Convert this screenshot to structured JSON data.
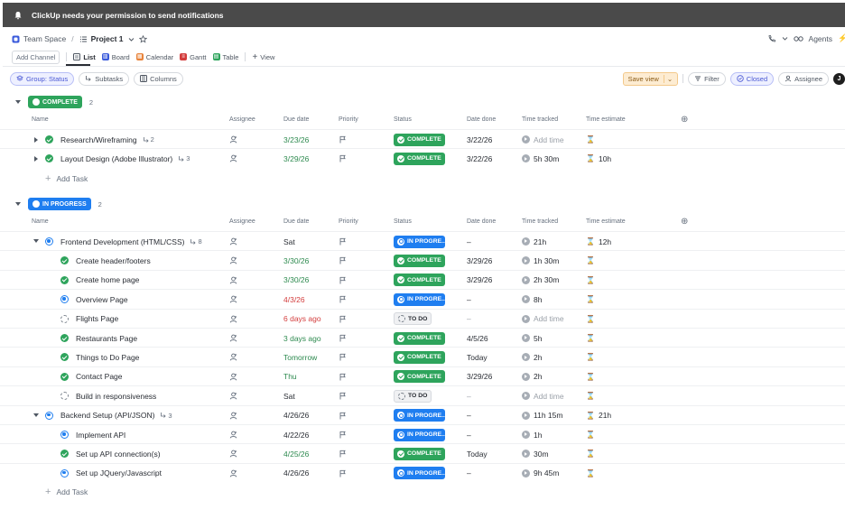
{
  "notification": {
    "text": "ClickUp needs your permission to send notifications"
  },
  "breadcrumb": {
    "space": "Team Space",
    "project": "Project 1"
  },
  "topright": {
    "agents": "Agents"
  },
  "views": {
    "add_channel": "Add Channel",
    "list": "List",
    "board": "Board",
    "calendar": "Calendar",
    "gantt": "Gantt",
    "table": "Table",
    "add_view": "View"
  },
  "toolbar": {
    "group": "Group: Status",
    "subtasks": "Subtasks",
    "columns": "Columns",
    "save_view": "Save view",
    "filter": "Filter",
    "closed": "Closed",
    "assignee": "Assignee",
    "avatar": "J"
  },
  "columns": {
    "name": "Name",
    "assignee": "Assignee",
    "due_date": "Due date",
    "priority": "Priority",
    "status": "Status",
    "date_done": "Date done",
    "time_tracked": "Time tracked",
    "time_estimate": "Time estimate"
  },
  "add_task": "Add Task",
  "colors": {
    "complete": "#2ea45c",
    "in_progress": "#1f7ef0",
    "todo": "#f0f1f3"
  },
  "groups": [
    {
      "label": "COMPLETE",
      "status": "complete",
      "count": "2",
      "tasks": [
        {
          "name": "Research/Wireframing",
          "status": "complete",
          "status_label": "COMPLETE",
          "subtasks": "2",
          "due": "3/23/26",
          "due_color": "green",
          "done": "3/22/26",
          "tracked": "Add time",
          "tracked_muted": true,
          "estimate": ""
        },
        {
          "name": "Layout Design (Adobe Illustrator)",
          "status": "complete",
          "status_label": "COMPLETE",
          "subtasks": "3",
          "due": "3/29/26",
          "due_color": "green",
          "done": "3/22/26",
          "tracked": "5h 30m",
          "tracked_muted": false,
          "estimate": "10h"
        }
      ]
    },
    {
      "label": "IN PROGRESS",
      "status": "progress",
      "count": "2",
      "tasks": [
        {
          "name": "Frontend Development (HTML/CSS)",
          "status": "progress",
          "status_label": "IN PROGRE...",
          "subtasks": "8",
          "expanded": true,
          "due": "Sat",
          "due_color": "plain",
          "done": "–",
          "tracked": "21h",
          "tracked_muted": false,
          "estimate": "12h"
        },
        {
          "name": "Create header/footers",
          "sub": true,
          "status": "complete",
          "status_label": "COMPLETE",
          "due": "3/30/26",
          "due_color": "green",
          "done": "3/29/26",
          "tracked": "1h 30m",
          "tracked_muted": false,
          "estimate": ""
        },
        {
          "name": "Create home page",
          "sub": true,
          "status": "complete",
          "status_label": "COMPLETE",
          "due": "3/30/26",
          "due_color": "green",
          "done": "3/29/26",
          "tracked": "2h 30m",
          "tracked_muted": false,
          "estimate": ""
        },
        {
          "name": "Overview Page",
          "sub": true,
          "status": "progress",
          "status_label": "IN PROGRE...",
          "due": "4/3/26",
          "due_color": "red",
          "done": "–",
          "tracked": "8h",
          "tracked_muted": false,
          "estimate": ""
        },
        {
          "name": "Flights Page",
          "sub": true,
          "status": "todo",
          "status_label": "TO DO",
          "due": "6 days ago",
          "due_color": "red",
          "done": "–",
          "tracked": "Add time",
          "tracked_muted": true,
          "estimate": ""
        },
        {
          "name": "Restaurants Page",
          "sub": true,
          "status": "complete",
          "status_label": "COMPLETE",
          "due": "3 days ago",
          "due_color": "green",
          "done": "4/5/26",
          "tracked": "5h",
          "tracked_muted": false,
          "estimate": ""
        },
        {
          "name": "Things to Do Page",
          "sub": true,
          "status": "complete",
          "status_label": "COMPLETE",
          "due": "Tomorrow",
          "due_color": "green",
          "done": "Today",
          "tracked": "2h",
          "tracked_muted": false,
          "estimate": ""
        },
        {
          "name": "Contact Page",
          "sub": true,
          "status": "complete",
          "status_label": "COMPLETE",
          "due": "Thu",
          "due_color": "green",
          "done": "3/29/26",
          "tracked": "2h",
          "tracked_muted": false,
          "estimate": ""
        },
        {
          "name": "Build in responsiveness",
          "sub": true,
          "status": "todo",
          "status_label": "TO DO",
          "due": "Sat",
          "due_color": "plain",
          "done": "–",
          "tracked": "Add time",
          "tracked_muted": true,
          "estimate": ""
        },
        {
          "name": "Backend Setup (API/JSON)",
          "status": "progress",
          "status_label": "IN PROGRE...",
          "subtasks": "3",
          "expanded": true,
          "due": "4/26/26",
          "due_color": "plain",
          "done": "–",
          "tracked": "11h 15m",
          "tracked_muted": false,
          "estimate": "21h"
        },
        {
          "name": "Implement API",
          "sub": true,
          "status": "progress",
          "status_label": "IN PROGRE...",
          "due": "4/22/26",
          "due_color": "plain",
          "done": "–",
          "tracked": "1h",
          "tracked_muted": false,
          "estimate": ""
        },
        {
          "name": "Set up API connection(s)",
          "sub": true,
          "status": "complete",
          "status_label": "COMPLETE",
          "due": "4/25/26",
          "due_color": "green",
          "done": "Today",
          "tracked": "30m",
          "tracked_muted": false,
          "estimate": ""
        },
        {
          "name": "Set up JQuery/Javascript",
          "sub": true,
          "status": "progress",
          "status_label": "IN PROGRE...",
          "due": "4/26/26",
          "due_color": "plain",
          "done": "–",
          "tracked": "9h 45m",
          "tracked_muted": false,
          "estimate": ""
        }
      ]
    }
  ]
}
